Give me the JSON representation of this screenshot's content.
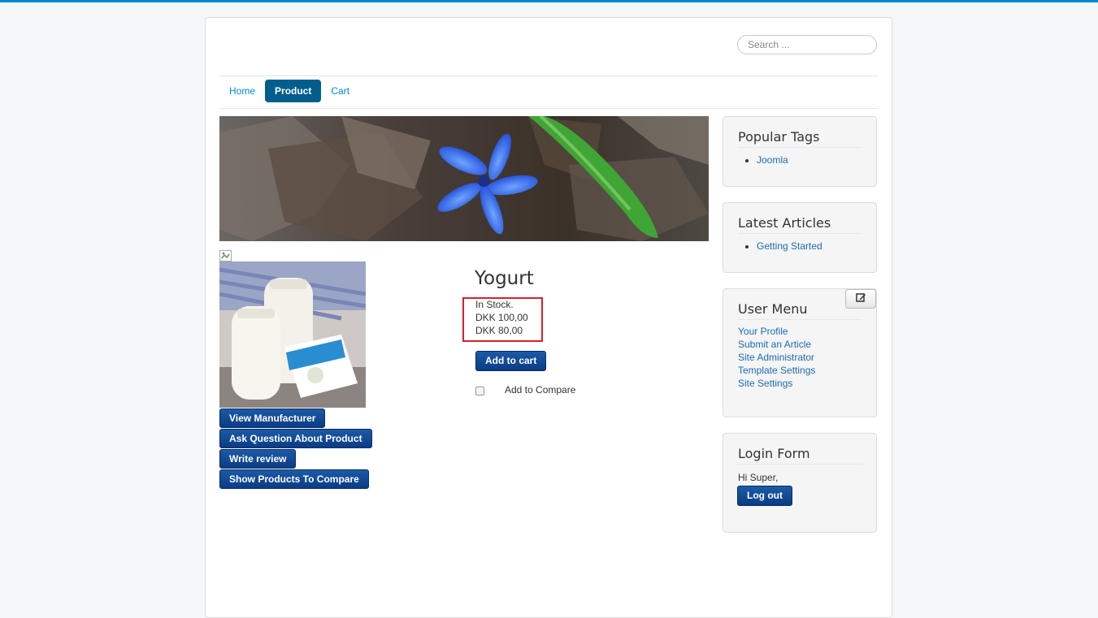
{
  "header": {
    "search_placeholder": "Search ..."
  },
  "nav": {
    "items": [
      {
        "label": "Home",
        "active": false
      },
      {
        "label": "Product",
        "active": true
      },
      {
        "label": "Cart",
        "active": false
      }
    ]
  },
  "product": {
    "title": "Yogurt",
    "stock": "In Stock.",
    "price_original": "DKK 100,00",
    "price_sale": "DKK 80,00",
    "add_to_cart": "Add to cart",
    "add_to_compare": "Add to Compare",
    "buttons": {
      "view_manufacturer": "View Manufacturer",
      "ask_question": "Ask Question About Product",
      "write_review": "Write review",
      "show_compare": "Show Products To Compare"
    }
  },
  "sidebar": {
    "popular_tags": {
      "title": "Popular Tags",
      "items": [
        "Joomla"
      ]
    },
    "latest_articles": {
      "title": "Latest Articles",
      "items": [
        "Getting Started"
      ]
    },
    "user_menu": {
      "title": "User Menu",
      "items": [
        "Your Profile",
        "Submit an Article",
        "Site Administrator",
        "Template Settings",
        "Site Settings"
      ]
    },
    "login_form": {
      "title": "Login Form",
      "greeting": "Hi Super,",
      "logout": "Log out"
    }
  },
  "colors": {
    "accent_top_border": "#0088cc",
    "nav_active": "#005e8d",
    "button_blue": "#0a3c85",
    "highlight_box": "#d6202e",
    "link": "#1d6bb4"
  }
}
